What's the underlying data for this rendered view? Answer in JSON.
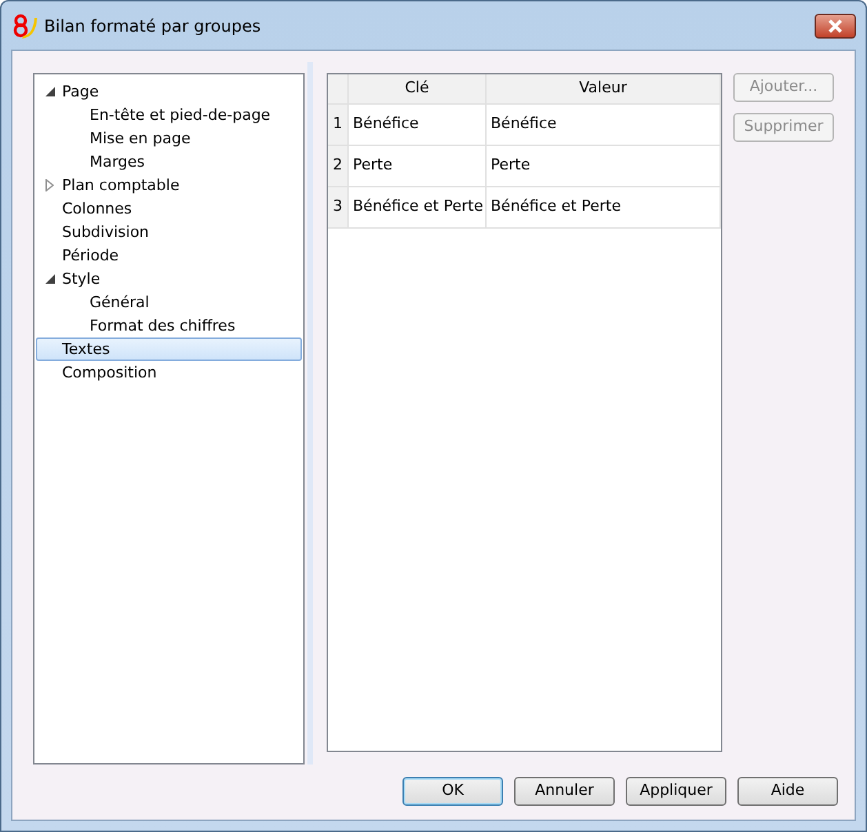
{
  "window": {
    "title": "Bilan formaté par groupes"
  },
  "tree": [
    {
      "label": "Page",
      "expanded": true,
      "selected": false,
      "children": [
        {
          "label": "En-tête et pied-de-page",
          "selected": false
        },
        {
          "label": "Mise en page",
          "selected": false
        },
        {
          "label": "Marges",
          "selected": false
        }
      ]
    },
    {
      "label": "Plan comptable",
      "expanded": false,
      "selected": false
    },
    {
      "label": "Colonnes",
      "selected": false
    },
    {
      "label": "Subdivision",
      "selected": false
    },
    {
      "label": "Période",
      "selected": false
    },
    {
      "label": "Style",
      "expanded": true,
      "selected": false,
      "children": [
        {
          "label": "Général",
          "selected": false
        },
        {
          "label": "Format des chiffres",
          "selected": false
        }
      ]
    },
    {
      "label": "Textes",
      "selected": true
    },
    {
      "label": "Composition",
      "selected": false
    }
  ],
  "table": {
    "columns": [
      "Clé",
      "Valeur"
    ],
    "rows": [
      {
        "number": "1",
        "cells": [
          "Bénéfice",
          "Bénéfice"
        ]
      },
      {
        "number": "2",
        "cells": [
          "Perte",
          "Perte"
        ]
      },
      {
        "number": "3",
        "cells": [
          "Bénéfice et Perte",
          "Bénéfice et Perte"
        ]
      }
    ]
  },
  "side_buttons": [
    {
      "label": "Ajouter...",
      "disabled": true
    },
    {
      "label": "Supprimer",
      "disabled": true
    }
  ],
  "buttons": [
    {
      "label": "OK",
      "default": true
    },
    {
      "label": "Annuler",
      "default": false
    },
    {
      "label": "Appliquer",
      "default": false
    },
    {
      "label": "Aide",
      "default": false
    }
  ]
}
